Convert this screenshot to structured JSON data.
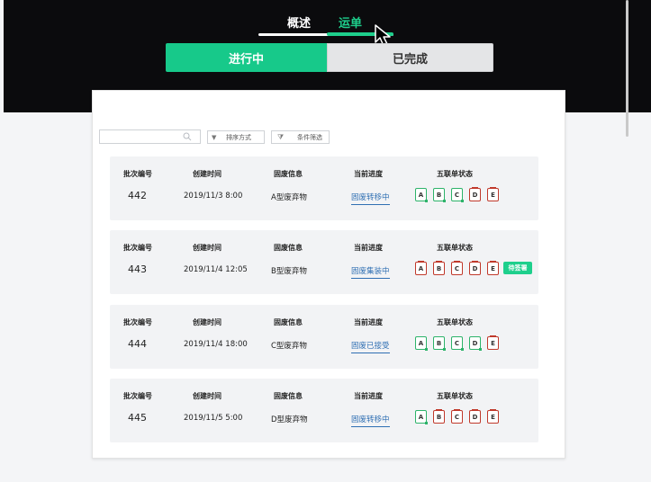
{
  "top_tabs": [
    {
      "label": "概述",
      "active": false
    },
    {
      "label": "运单",
      "active": true
    }
  ],
  "segments": {
    "in_progress": "进行中",
    "completed": "已完成"
  },
  "toolbar": {
    "search_value": "",
    "sort_label": "排序方式",
    "filter_label": "条件筛选"
  },
  "columns": {
    "batch": "批次编号",
    "created": "创建时间",
    "waste": "固废信息",
    "progress": "当前进度",
    "forms": "五联单状态"
  },
  "rows": [
    {
      "batch": "442",
      "created": "2019/11/3 8:00",
      "waste": "A型废弃物",
      "progress": "固废转移中",
      "forms": [
        {
          "label": "A",
          "state": "green"
        },
        {
          "label": "B",
          "state": "green"
        },
        {
          "label": "C",
          "state": "green"
        },
        {
          "label": "D",
          "state": "red"
        },
        {
          "label": "E",
          "state": "red"
        }
      ],
      "badge": ""
    },
    {
      "batch": "443",
      "created": "2019/11/4 12:05",
      "waste": "B型废弃物",
      "progress": "固废集装中",
      "forms": [
        {
          "label": "A",
          "state": "red"
        },
        {
          "label": "B",
          "state": "red"
        },
        {
          "label": "C",
          "state": "red"
        },
        {
          "label": "D",
          "state": "red"
        },
        {
          "label": "E",
          "state": "red"
        }
      ],
      "badge": "待签署"
    },
    {
      "batch": "444",
      "created": "2019/11/4 18:00",
      "waste": "C型废弃物",
      "progress": "固废已接受",
      "forms": [
        {
          "label": "A",
          "state": "green"
        },
        {
          "label": "B",
          "state": "green"
        },
        {
          "label": "C",
          "state": "green"
        },
        {
          "label": "D",
          "state": "green"
        },
        {
          "label": "E",
          "state": "red"
        }
      ],
      "badge": ""
    },
    {
      "batch": "445",
      "created": "2019/11/5 5:00",
      "waste": "D型废弃物",
      "progress": "固废转移中",
      "forms": [
        {
          "label": "A",
          "state": "green"
        },
        {
          "label": "B",
          "state": "red"
        },
        {
          "label": "C",
          "state": "red"
        },
        {
          "label": "D",
          "state": "red"
        },
        {
          "label": "E",
          "state": "red"
        }
      ],
      "badge": ""
    }
  ],
  "colors": {
    "accent": "#1ecf8c",
    "link": "#2f6fb3",
    "form_done": "#2db36a",
    "form_pending": "#c0392b",
    "header_bg": "#0b0b0d"
  },
  "icons": {
    "search": "search-icon",
    "sort": "sort-icon",
    "filter": "filter-icon",
    "cursor": "cursor-icon"
  }
}
